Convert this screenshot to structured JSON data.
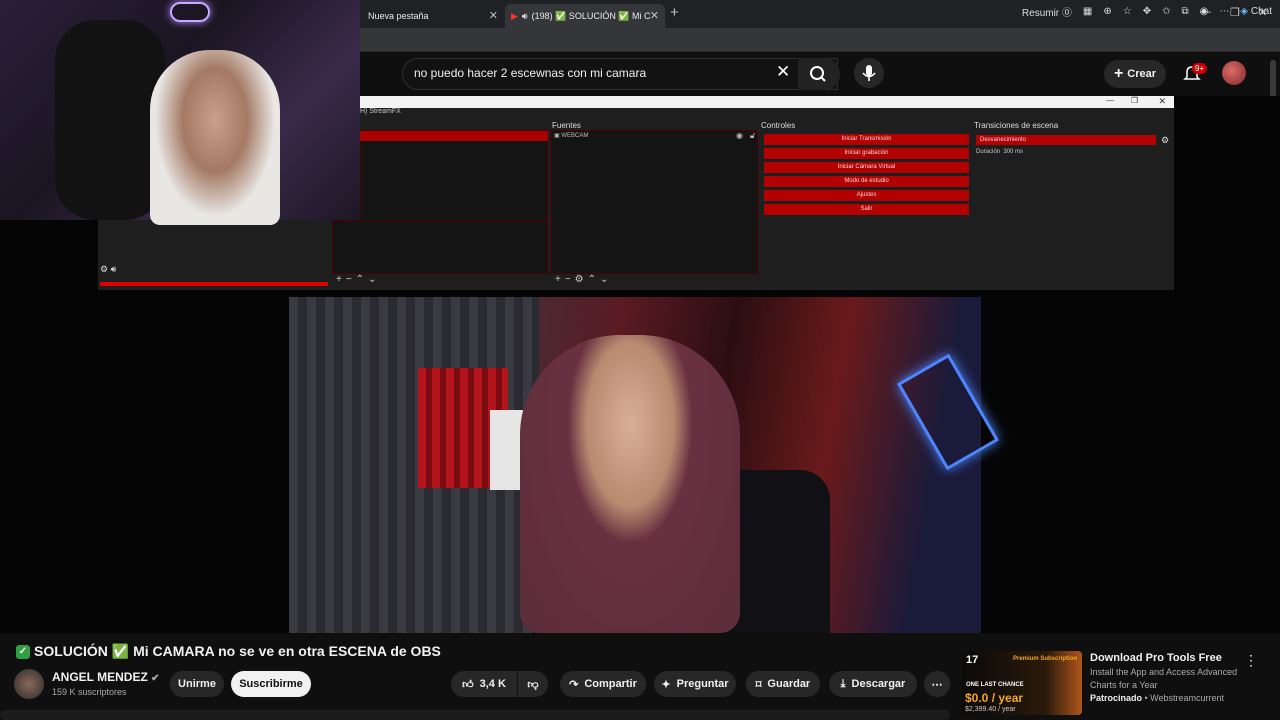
{
  "browser": {
    "tabs": [
      {
        "label": "Nueva pestaña"
      },
      {
        "label": "(198) ✅ SOLUCIÓN ✅ Mi C"
      }
    ],
    "summarize_label": "Resumir",
    "chat_label": "Chat"
  },
  "youtube": {
    "search_value": "no puedo hacer 2 escewnas con mi camara",
    "create_label": "Crear",
    "notif_badge": "9+"
  },
  "obs": {
    "menu_item": "StreamFX",
    "panel_sources": "Fuentes",
    "panel_controls": "Controles",
    "panel_transitions": "Transiciones de escena",
    "source_item": "WEBCAM",
    "controls": [
      "Iniciar Transmisión",
      "Iniciar grabación",
      "Iniciar Cámara Virtual",
      "Modo de estudio",
      "Ajustes",
      "Salir"
    ],
    "transition_value": "Desvanecimiento",
    "duration_label": "Duración",
    "duration_value": "300 ms"
  },
  "video": {
    "title": "SOLUCIÓN ✅ Mi CAMARA no se ve en otra ESCENA de OBS",
    "channel": "ANGEL MENDEZ",
    "subscribers": "159 K suscriptores",
    "join": "Unirme",
    "subscribe": "Suscribirme",
    "likes": "3,4 K",
    "share": "Compartir",
    "ask": "Preguntar",
    "save": "Guardar",
    "download": "Descargar"
  },
  "ad": {
    "title": "Download Pro Tools Free",
    "description": "Install the App and Access Advanced Charts for a Year",
    "sponsored": "Patrocinado",
    "advertiser": "Webstreamcurrent",
    "thumb_brand": "17",
    "thumb_premium": "Premium Subscription",
    "thumb_last": "ONE LAST CHANCE",
    "thumb_price": "$0.0 / year",
    "thumb_old": "$2,399.40 / year"
  }
}
